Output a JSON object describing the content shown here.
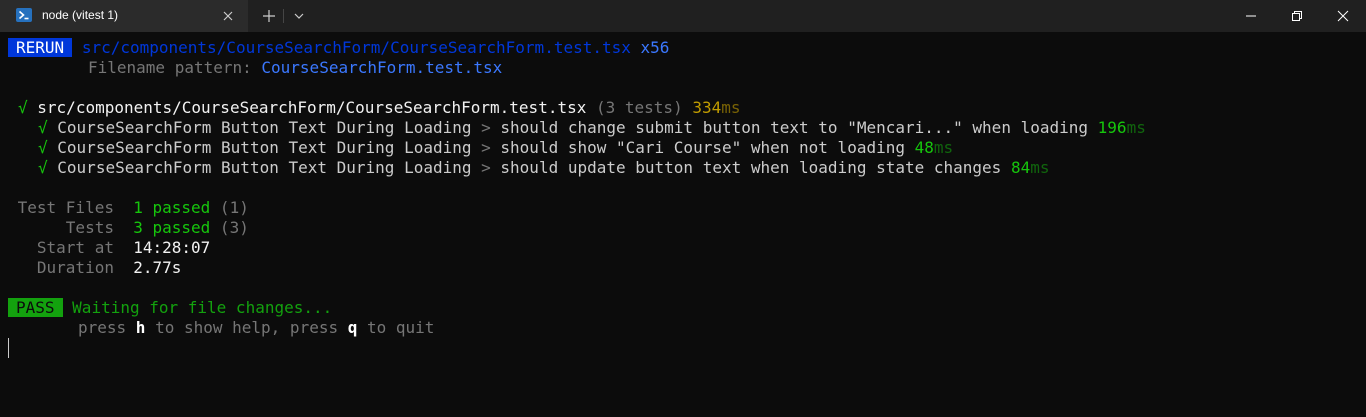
{
  "titlebar": {
    "tab_title": "node (vitest 1)"
  },
  "rerun": {
    "badge": "RERUN",
    "path": "src/components/CourseSearchForm/CourseSearchForm.test.tsx",
    "count": "x56",
    "pattern_label": "Filename pattern: ",
    "pattern_value": "CourseSearchForm.test.tsx"
  },
  "suite": {
    "check": "√",
    "path": "src/components/CourseSearchForm/CourseSearchForm.test.tsx",
    "tests": "(3 tests)",
    "time_value": "334",
    "time_unit": "ms"
  },
  "tests": [
    {
      "check": "√",
      "describe": "CourseSearchForm Button Text During Loading",
      "sep": " > ",
      "name": "should change submit button text to \"Mencari...\" when loading",
      "time_value": "196",
      "time_unit": "ms"
    },
    {
      "check": "√",
      "describe": "CourseSearchForm Button Text During Loading",
      "sep": " > ",
      "name": "should show \"Cari Course\" when not loading",
      "time_value": "48",
      "time_unit": "ms"
    },
    {
      "check": "√",
      "describe": "CourseSearchForm Button Text During Loading",
      "sep": " > ",
      "name": "should update button text when loading state changes",
      "time_value": "84",
      "time_unit": "ms"
    }
  ],
  "summary": {
    "files_label": " Test Files  ",
    "files_passed": "1 passed",
    "files_total": " (1)",
    "tests_label": "      Tests  ",
    "tests_passed": "3 passed",
    "tests_total": " (3)",
    "start_label": "   Start at  ",
    "start_value": "14:28:07",
    "duration_label": "   Duration  ",
    "duration_value": "2.77s"
  },
  "status": {
    "badge": "PASS",
    "message": "Waiting for file changes...",
    "help_press1": "press ",
    "help_key1": "h",
    "help_text1": " to show help, press ",
    "help_key2": "q",
    "help_text2": " to quit"
  },
  "colors": {
    "background": "#0c0c0c",
    "titlebar": "#202020",
    "tab": "#2b2b2b",
    "pass_badge": "#13a10e",
    "rerun_badge": "#0037da",
    "green": "#16c60c",
    "yellow": "#c19c00",
    "blue": "#3b78ff"
  },
  "icons": {
    "tab_icon": "powershell-icon",
    "tab_close": "close-icon",
    "new_tab": "plus-icon",
    "dropdown": "chevron-down-icon",
    "minimize": "minimize-icon",
    "maximize": "restore-icon",
    "close": "close-icon"
  }
}
